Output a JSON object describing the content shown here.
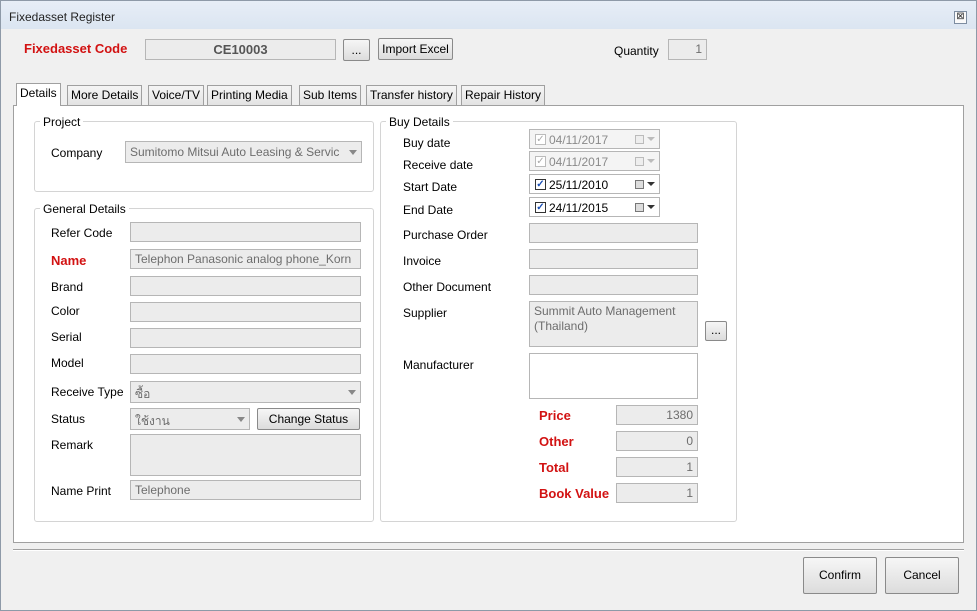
{
  "window": {
    "title": "Fixedasset Register",
    "close_glyph": "⊠"
  },
  "header": {
    "code_label": "Fixedasset Code",
    "code_value": "CE10003",
    "browse_label": "...",
    "import_label": "Import Excel",
    "quantity_label": "Quantity",
    "quantity_value": "1"
  },
  "tabs": [
    "Details",
    "More Details",
    "Voice/TV",
    "Printing Media",
    "Sub Items",
    "Transfer history",
    "Repair History"
  ],
  "project": {
    "title": "Project",
    "company_label": "Company",
    "company_value": "Sumitomo Mitsui Auto Leasing & Servic"
  },
  "general": {
    "title": "General Details",
    "refer_code_label": "Refer Code",
    "refer_code_value": "",
    "name_label": "Name",
    "name_value": "Telephon Panasonic analog phone_Korn",
    "brand_label": "Brand",
    "brand_value": "",
    "color_label": "Color",
    "color_value": "",
    "serial_label": "Serial",
    "serial_value": "",
    "model_label": "Model",
    "model_value": "",
    "receive_type_label": "Receive Type",
    "receive_type_value": "ซื้อ",
    "status_label": "Status",
    "status_value": "ใช้งาน",
    "change_status_label": "Change Status",
    "remark_label": "Remark",
    "remark_value": "",
    "name_print_label": "Name Print",
    "name_print_value": "Telephone"
  },
  "buy": {
    "title": "Buy Details",
    "buy_date_label": "Buy date",
    "buy_date_value": "04/11/2017",
    "receive_date_label": "Receive date",
    "receive_date_value": "04/11/2017",
    "start_date_label": "Start Date",
    "start_date_value": "25/11/2010",
    "end_date_label": "End Date",
    "end_date_value": "24/11/2015",
    "po_label": "Purchase Order",
    "po_value": "",
    "invoice_label": "Invoice",
    "invoice_value": "",
    "other_doc_label": "Other Document",
    "other_doc_value": "",
    "supplier_label": "Supplier",
    "supplier_value": "Summit Auto Management (Thailand)",
    "supplier_browse": "...",
    "manufacturer_label": "Manufacturer",
    "manufacturer_value": "",
    "price_label": "Price",
    "price_value": "1380",
    "other_label": "Other",
    "other_value": "0",
    "total_label": "Total",
    "total_value": "1",
    "book_value_label": "Book Value",
    "book_value_value": "1"
  },
  "footer": {
    "confirm_label": "Confirm",
    "cancel_label": "Cancel"
  },
  "colors": {
    "required_label": "#d21212",
    "disabled_field": "#ececec"
  }
}
